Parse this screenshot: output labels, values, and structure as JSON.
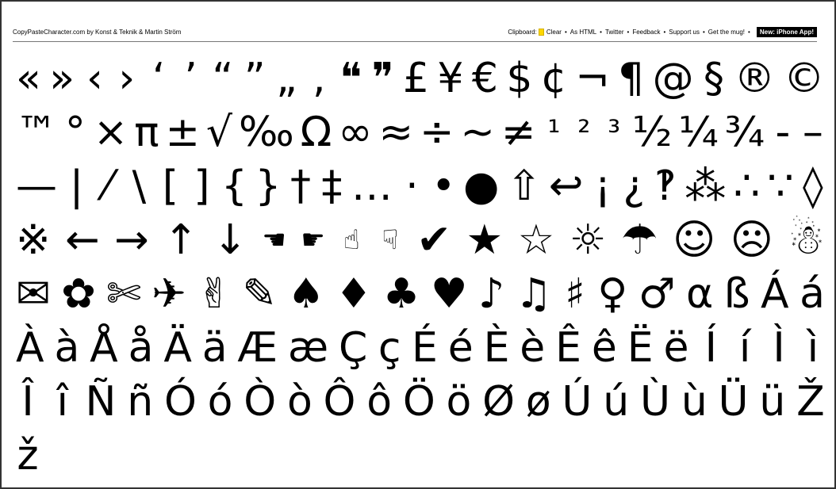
{
  "header": {
    "site_credit": "CopyPasteCharacter.com by Konst & Teknik & Martin Ström",
    "clipboard_label": "Clipboard:",
    "links": [
      "Clear",
      "As HTML",
      "Twitter",
      "Feedback",
      "Support us",
      "Get the mug!"
    ],
    "new_label": "New: iPhone App!",
    "separator": "•"
  },
  "rows": [
    [
      "«",
      "»",
      "‹",
      "›",
      "‘",
      "’",
      "“",
      "”",
      "„",
      "‚",
      "❝",
      "❞",
      "£",
      "¥",
      "€",
      "$",
      "¢",
      "¬",
      "¶",
      "@",
      "§",
      "®",
      "©"
    ],
    [
      "™",
      "°",
      "×",
      "π",
      "±",
      "√",
      "‰",
      "Ω",
      "∞",
      "≈",
      "÷",
      "~",
      "≠",
      "¹",
      "²",
      "³",
      "½",
      "¼",
      "¾",
      "-",
      "–"
    ],
    [
      "—",
      "|",
      "⁄",
      "\\",
      "[",
      "]",
      "{",
      "}",
      "†",
      "‡",
      "…",
      "·",
      "•",
      "●",
      "⇧",
      "↩",
      "¡",
      "¿",
      "‽",
      "⁂",
      "∴",
      "∵",
      "◊"
    ],
    [
      "※",
      "←",
      "→",
      "↑",
      "↓",
      "☚",
      "☛",
      "☝",
      "☟",
      "✔",
      "★",
      "☆",
      "☼",
      "☂",
      "☺",
      "☹",
      "☃"
    ],
    [
      "✉",
      "✿",
      "✄",
      "✈",
      "✌",
      "✎",
      "♠",
      "♦",
      "♣",
      "♥",
      "♪",
      "♫",
      "♯",
      "♀",
      "♂",
      "α",
      "ß",
      "Á",
      "á"
    ],
    [
      "À",
      "à",
      "Å",
      "å",
      "Ä",
      "ä",
      "Æ",
      "æ",
      "Ç",
      "ç",
      "É",
      "é",
      "È",
      "è",
      "Ê",
      "ê",
      "Ë",
      "ë",
      "Í",
      "í",
      "Ì",
      "ì"
    ],
    [
      "Î",
      "î",
      "Ñ",
      "ñ",
      "Ó",
      "ó",
      "Ò",
      "ò",
      "Ô",
      "ô",
      "Ö",
      "ö",
      "Ø",
      "ø",
      "Ú",
      "ú",
      "Ù",
      "ù",
      "Ü",
      "ü",
      "Ž"
    ],
    [
      "ž"
    ]
  ]
}
